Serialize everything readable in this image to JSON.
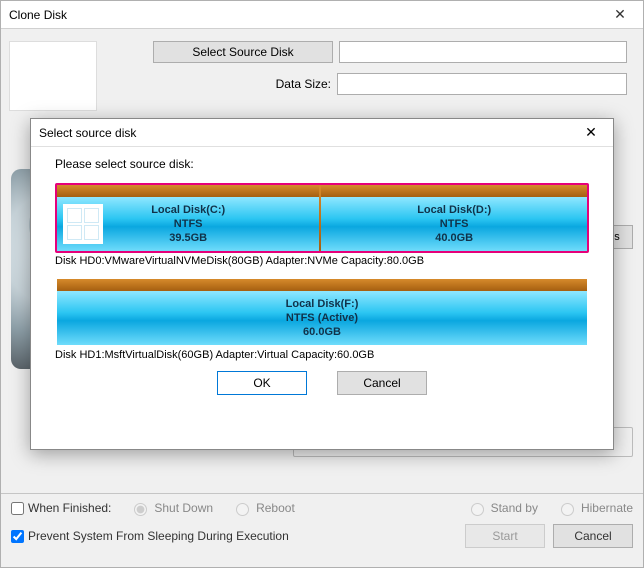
{
  "window": {
    "title": "Clone Disk",
    "selectSourceLabel": "Select Source Disk",
    "dataSizeLabel": "Data Size:"
  },
  "optionsButton": "ns",
  "bottom": {
    "whenFinished": "When Finished:",
    "shutDown": "Shut Down",
    "reboot": "Reboot",
    "standBy": "Stand by",
    "hibernate": "Hibernate",
    "preventSleep": "Prevent System From Sleeping During Execution",
    "start": "Start",
    "cancel": "Cancel"
  },
  "modal": {
    "title": "Select source disk",
    "prompt": "Please select source disk:",
    "ok": "OK",
    "cancel": "Cancel",
    "disk0": {
      "partC": {
        "name": "Local Disk(C:)",
        "fs": "NTFS",
        "size": "39.5GB"
      },
      "partD": {
        "name": "Local Disk(D:)",
        "fs": "NTFS",
        "size": "40.0GB"
      },
      "info": "Disk HD0:VMwareVirtualNVMeDisk(80GB)  Adapter:NVMe  Capacity:80.0GB"
    },
    "disk1": {
      "partF": {
        "name": "Local Disk(F:)",
        "fs": "NTFS (Active)",
        "size": "60.0GB"
      },
      "info": "Disk HD1:MsftVirtualDisk(60GB)  Adapter:Virtual  Capacity:60.0GB"
    }
  }
}
